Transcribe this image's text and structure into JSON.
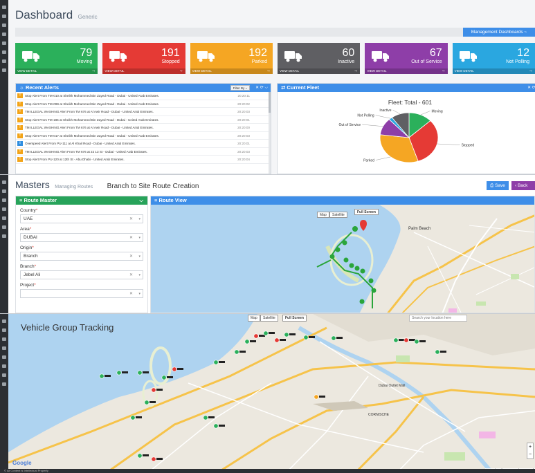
{
  "dashboard": {
    "title": "Dashboard",
    "subtitle": "Generic",
    "mgmt_button": "Management Dashboards ~",
    "tiles": [
      {
        "value": "79",
        "label": "Moving",
        "color": "#2bb05b",
        "view": "VIEW DETAIL"
      },
      {
        "value": "191",
        "label": "Stopped",
        "color": "#e53a35",
        "view": "VIEW DETAIL"
      },
      {
        "value": "192",
        "label": "Parked",
        "color": "#f5a623",
        "view": "VIEW DETAIL"
      },
      {
        "value": "60",
        "label": "Inactive",
        "color": "#5f5f63",
        "view": "VIEW DETAIL"
      },
      {
        "value": "67",
        "label": "Out of Service",
        "color": "#8e3ea8",
        "view": "VIEW DETAIL"
      },
      {
        "value": "12",
        "label": "Not Polling",
        "color": "#2aa7e0",
        "view": "VIEW DETAIL"
      }
    ],
    "alerts": {
      "title": "☼ Recent Alerts",
      "filter": "Filter By ~",
      "tools": "✕ ⟳ ⌵",
      "rows": [
        {
          "icon": "warning",
          "text": "Stop Alert From TM-010 at Sheikh Mohammed Bin Zayed Road - Dubai - United Arab Emirates.",
          "time": "20:20:11"
        },
        {
          "icon": "warning",
          "text": "Stop Alert From TM-099 at Sheikh Mohammed Bin Zayed Road - Dubai - United Arab Emirates.",
          "time": "20:20:02"
        },
        {
          "icon": "warning",
          "text": "TM ILLEGAL WASHING Alert From TM 676 at Al Awir Road - Dubai - United Arab Emirates.",
          "time": "20:20:03"
        },
        {
          "icon": "warning",
          "text": "Stop Alert From TM 186 at Sheikh Mohammed Bin Zayed Road - Dubai - United Arab Emirates.",
          "time": "20:20:01"
        },
        {
          "icon": "warning",
          "text": "TM ILLEGAL WASHING Alert From TM 676 at Al Awir Road - Dubai - United Arab Emirates.",
          "time": "20:20:00"
        },
        {
          "icon": "warning",
          "text": "Stop Alert From TM-017 at Sheikh Mohammed Bin Zayed Road - Dubai - United Arab Emirates.",
          "time": "20:20:03"
        },
        {
          "icon": "info",
          "text": "Overspeed Alert From PU-111 at Al Khail Road - Dubai - United Arab Emirates.",
          "time": "20:20:01"
        },
        {
          "icon": "warning",
          "text": "TM ILLEGAL WASHING Alert From TM 676 at 22 13 St - Dubai - United Arab Emirates.",
          "time": "20:20:03"
        },
        {
          "icon": "warning",
          "text": "Stop Alert From PU-120 at 12th St - Abu Dhabi - United Arab Emirates.",
          "time": "20:20:04"
        }
      ]
    },
    "fleet": {
      "title": "⇄ Current Fleet",
      "tools": "✕ ⟳ ⌵",
      "chart_title": "Fleet: Total - 601"
    }
  },
  "chart_data": {
    "type": "pie",
    "title": "Fleet: Total - 601",
    "slices": [
      {
        "name": "Moving",
        "value": 79,
        "color": "#2bb05b"
      },
      {
        "name": "Stopped",
        "value": 191,
        "color": "#e53a35"
      },
      {
        "name": "Parked",
        "value": 192,
        "color": "#f5a623"
      },
      {
        "name": "Out of Service",
        "value": 67,
        "color": "#8e3ea8"
      },
      {
        "name": "Not Polling",
        "value": 12,
        "color": "#2aa7e0"
      },
      {
        "name": "Inactive",
        "value": 60,
        "color": "#5f5f63"
      }
    ]
  },
  "masters": {
    "title": "Masters",
    "subtitle": "Managing Routes",
    "page": "Branch to Site Route Creation",
    "save": "⎙ Save",
    "back": "‹ Back",
    "route_master": "≡ Route Master",
    "route_view": "≡ Route View",
    "map_btn": "Map",
    "sat_btn": "Satellite",
    "full_btn": "Full Screen",
    "fields": [
      {
        "label": "Country",
        "value": "UAE"
      },
      {
        "label": "Area",
        "value": "DUBAI"
      },
      {
        "label": "Origin",
        "value": "Branch"
      },
      {
        "label": "Branch",
        "value": "Jebel Ali"
      },
      {
        "label": "Project",
        "value": ""
      }
    ],
    "place": "Palm Beach"
  },
  "tracking": {
    "title": "Vehicle Group Tracking",
    "map_btn": "Map",
    "sat_btn": "Satellite",
    "full_btn": "Full Screen",
    "search_placeholder": "Search your location here",
    "google": "Google",
    "map_data": "Map data ©2016 Google  Terms of",
    "footer": "© All Content is Intellectual Property",
    "labels": [
      "Dubai Outlet Mall",
      "CORNISCHE"
    ]
  }
}
